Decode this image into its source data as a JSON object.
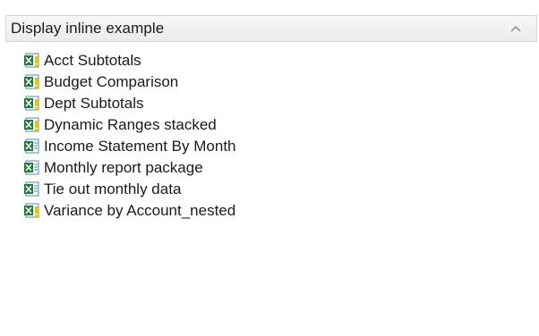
{
  "panel": {
    "title": "Display inline example",
    "collapse_icon": "chevron-up-icon"
  },
  "reports": [
    {
      "label": "Acct Subtotals",
      "icon": "excel-workbook-macro-icon"
    },
    {
      "label": "Budget Comparison",
      "icon": "excel-workbook-macro-icon"
    },
    {
      "label": "Dept Subtotals",
      "icon": "excel-workbook-macro-icon"
    },
    {
      "label": "Dynamic Ranges stacked",
      "icon": "excel-workbook-macro-icon"
    },
    {
      "label": "Income Statement By Month",
      "icon": "excel-workbook-icon"
    },
    {
      "label": "Monthly report package",
      "icon": "excel-workbook-icon"
    },
    {
      "label": "Tie out monthly data",
      "icon": "excel-workbook-icon"
    },
    {
      "label": "Variance by Account_nested",
      "icon": "excel-workbook-macro-icon"
    }
  ],
  "colors": {
    "excel_green": "#1e7b34",
    "sheet_bg": "#ffffff",
    "macro_yellow": "#f2c200",
    "doc_blue": "#4a86c5"
  }
}
